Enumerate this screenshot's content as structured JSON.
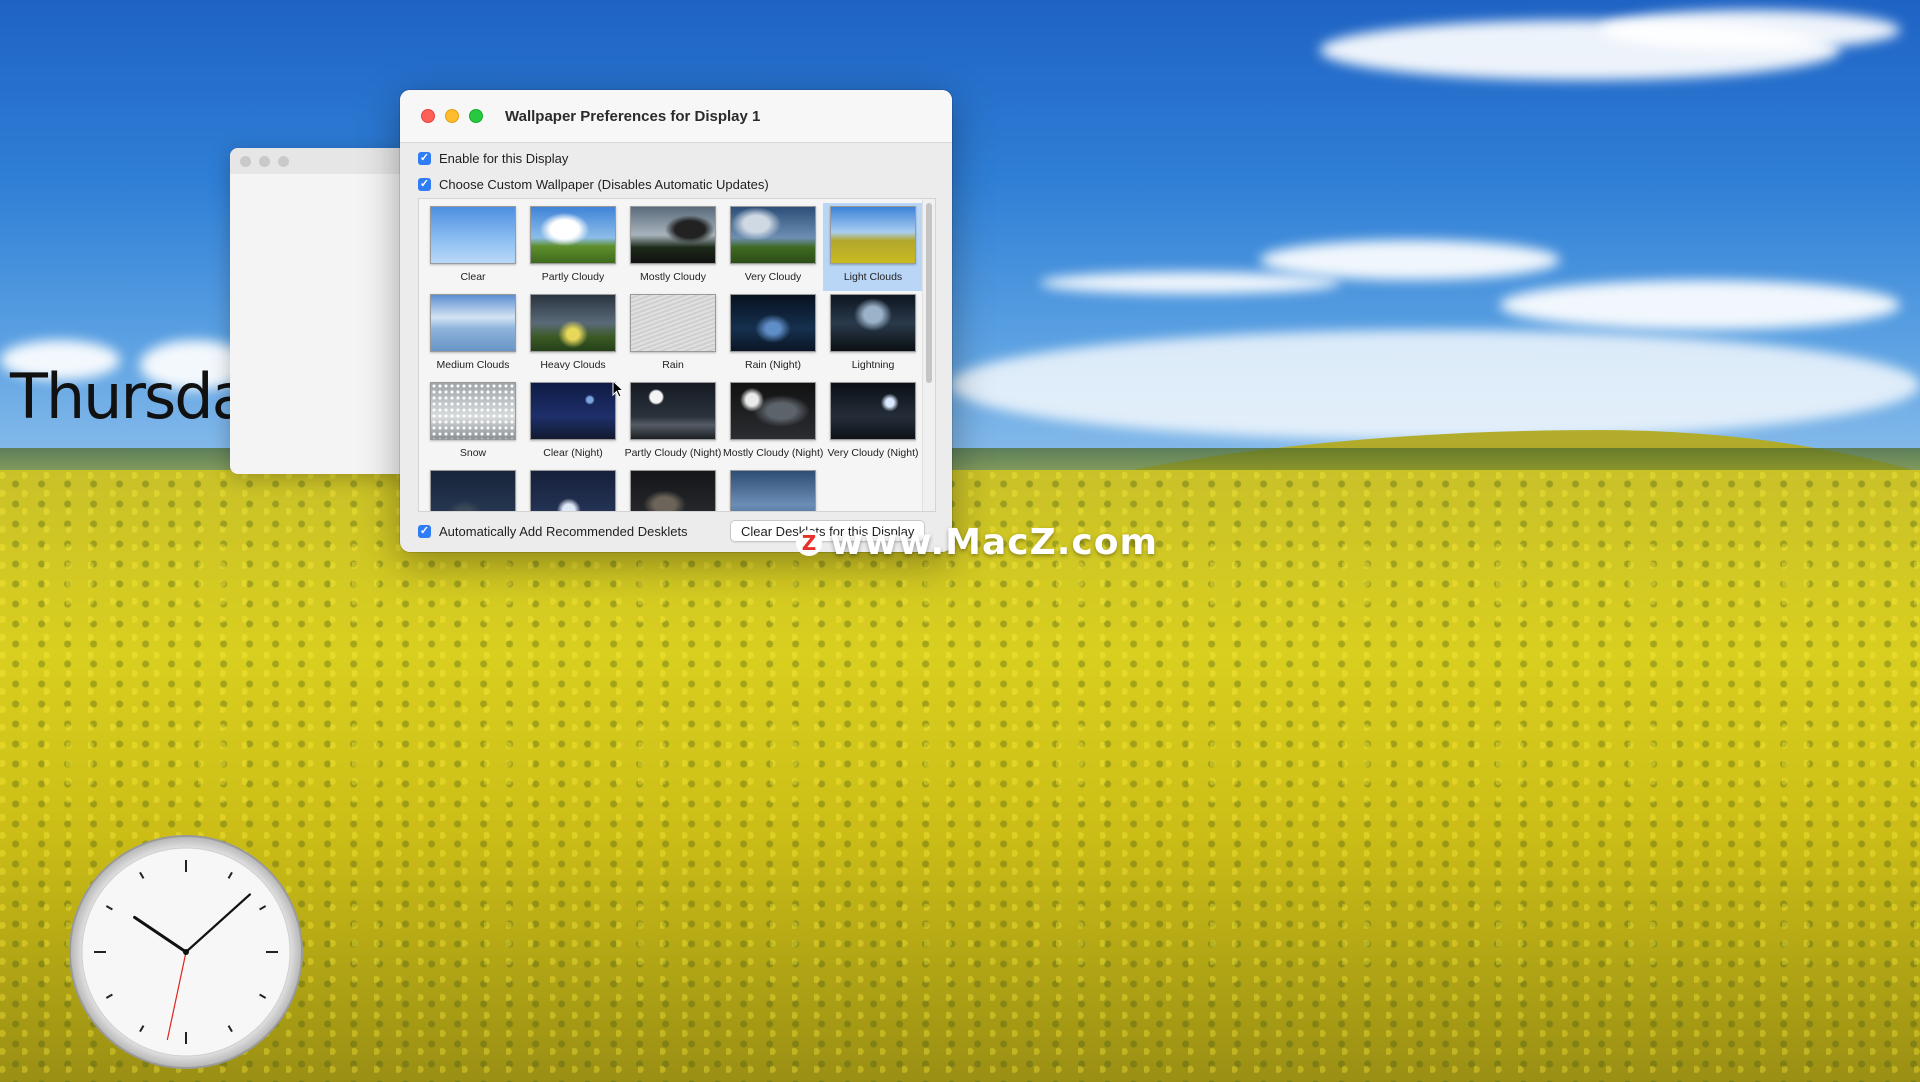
{
  "desktop": {
    "day_label": "Thursday"
  },
  "window": {
    "title": "Wallpaper Preferences for Display 1",
    "enable_label": "Enable for this Display",
    "enable_checked": true,
    "custom_label": "Choose Custom Wallpaper (Disables Automatic Updates)",
    "custom_checked": true,
    "auto_add_label": "Automatically Add Recommended Desklets",
    "auto_add_checked": true,
    "clear_button_label": "Clear Desklets for this Display",
    "selected_wallpaper": "Light Clouds"
  },
  "wallpapers": [
    {
      "label": "Clear",
      "style": "clear"
    },
    {
      "label": "Partly Cloudy",
      "style": "partly"
    },
    {
      "label": "Mostly Cloudy",
      "style": "mostly"
    },
    {
      "label": "Very Cloudy",
      "style": "very"
    },
    {
      "label": "Light Clouds",
      "style": "light"
    },
    {
      "label": "Medium Clouds",
      "style": "medium"
    },
    {
      "label": "Heavy Clouds",
      "style": "heavy"
    },
    {
      "label": "Rain",
      "style": "rain"
    },
    {
      "label": "Rain (Night)",
      "style": "rainnight"
    },
    {
      "label": "Lightning",
      "style": "lightning"
    },
    {
      "label": "Snow",
      "style": "snow"
    },
    {
      "label": "Clear (Night)",
      "style": "clearnight"
    },
    {
      "label": "Partly Cloudy (Night)",
      "style": "partlynight"
    },
    {
      "label": "Mostly Cloudy (Night)",
      "style": "mostlynight"
    },
    {
      "label": "Very Cloudy (Night)",
      "style": "verynight"
    },
    {
      "label": "",
      "style": "row4a"
    },
    {
      "label": "",
      "style": "row4b"
    },
    {
      "label": "",
      "style": "row4c"
    },
    {
      "label": "",
      "style": "row4d"
    }
  ],
  "watermark": {
    "logo_letter": "Z",
    "text": "www.MacZ.com"
  },
  "clock": {
    "hour": 10,
    "minute": 8,
    "second": 32
  }
}
